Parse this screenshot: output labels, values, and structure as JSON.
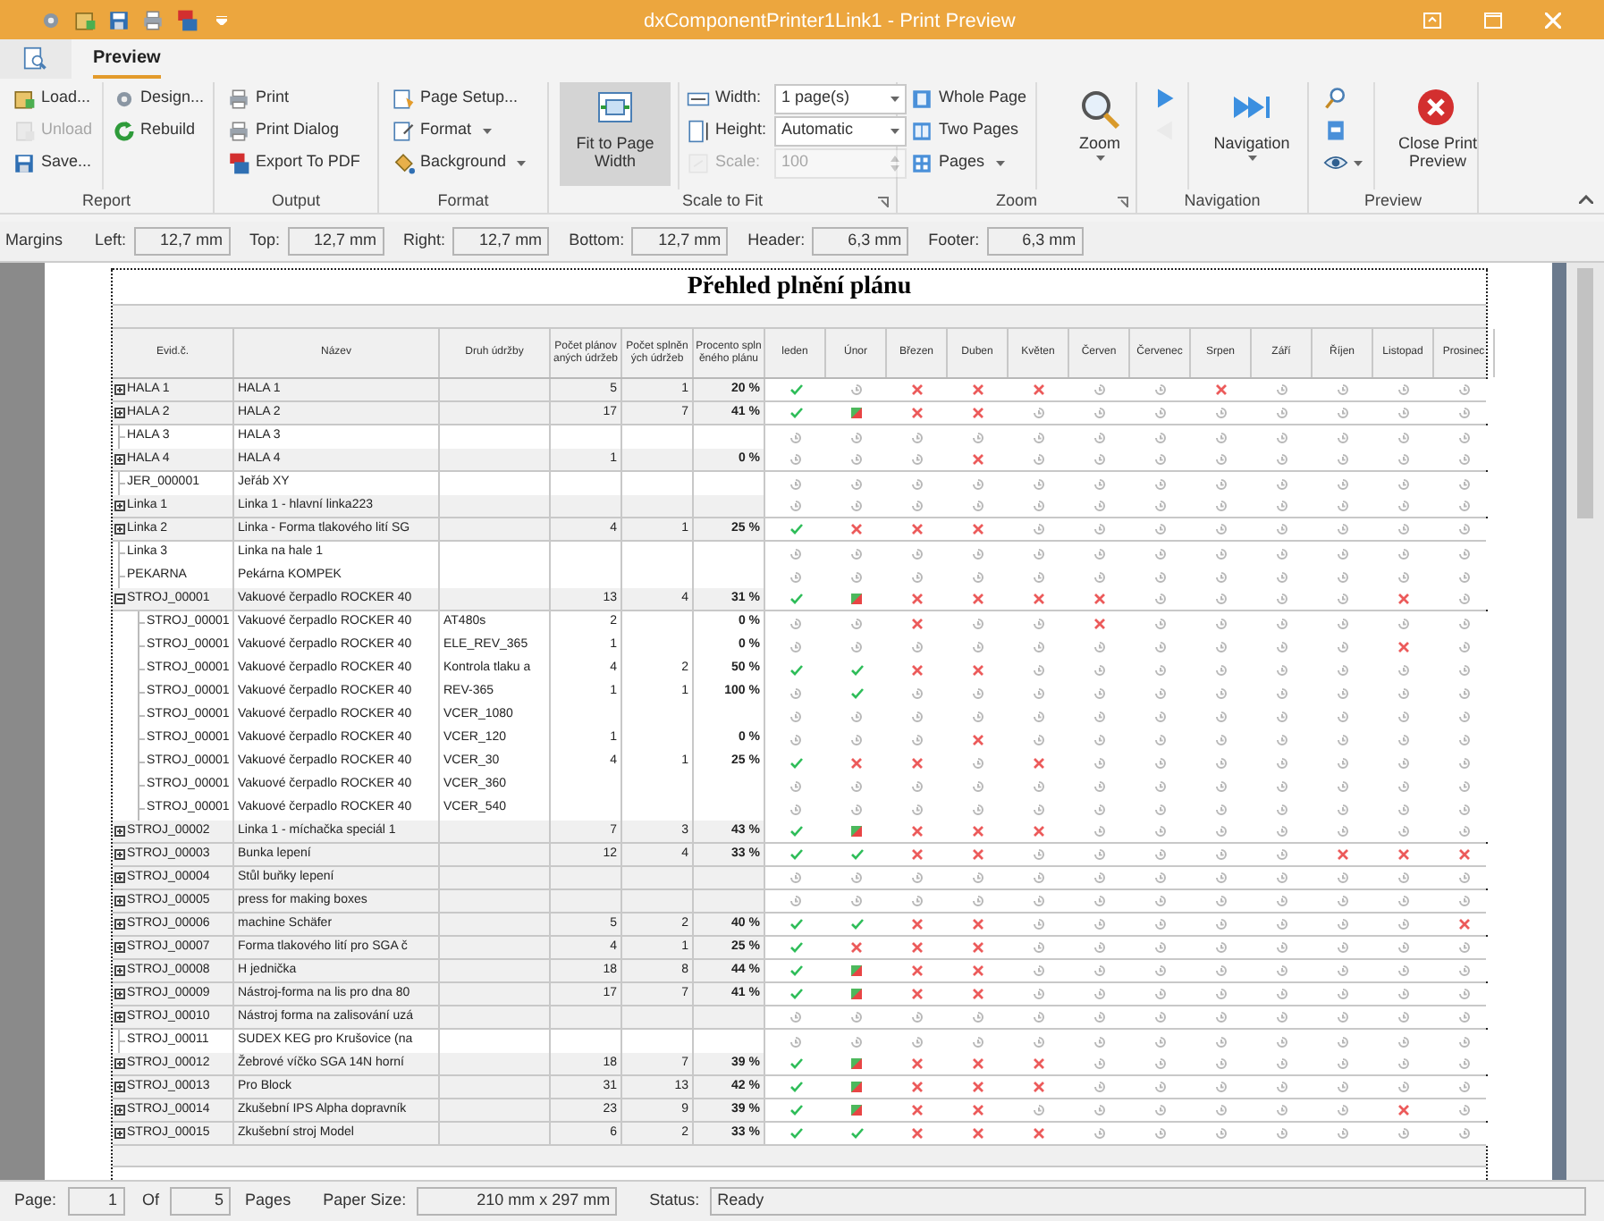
{
  "window": {
    "title": "dxComponentPrinter1Link1 - Print Preview"
  },
  "tabs": [
    {
      "label": "Preview",
      "selected": true
    }
  ],
  "ribbon": {
    "groups": [
      {
        "label": "Report",
        "launcher": false,
        "columns": [
          [
            {
              "kind": "small",
              "label": "Load...",
              "disabled": false
            },
            {
              "kind": "small",
              "label": "Unload",
              "disabled": true
            },
            {
              "kind": "small",
              "label": "Save...",
              "disabled": false
            }
          ],
          [
            {
              "kind": "small",
              "label": "Design...",
              "disabled": false
            },
            {
              "kind": "small",
              "label": "Rebuild",
              "disabled": false
            }
          ]
        ]
      },
      {
        "label": "Output",
        "launcher": false,
        "columns": [
          [
            {
              "kind": "small",
              "label": "Print",
              "disabled": false
            },
            {
              "kind": "small",
              "label": "Print Dialog",
              "disabled": false
            },
            {
              "kind": "small",
              "label": "Export To PDF",
              "disabled": false
            }
          ]
        ]
      },
      {
        "label": "Format",
        "launcher": false,
        "columns": [
          [
            {
              "kind": "small",
              "label": "Page Setup...",
              "disabled": false
            },
            {
              "kind": "small",
              "label": "Format",
              "disabled": false,
              "dropdown": true
            },
            {
              "kind": "small",
              "label": "Background",
              "disabled": false,
              "dropdown": true
            }
          ]
        ]
      },
      {
        "label": "Scale to Fit",
        "launcher": true,
        "columns": [
          [
            {
              "kind": "large",
              "label": "Fit to Page Width",
              "disabled": false,
              "selected": true
            }
          ],
          [
            {
              "kind": "combo",
              "label": "Width:",
              "value": "1 page(s)",
              "disabled": false
            },
            {
              "kind": "combo",
              "label": "Height:",
              "value": "Automatic",
              "disabled": false
            },
            {
              "kind": "spin",
              "label": "Scale:",
              "value": "100",
              "disabled": true
            }
          ]
        ]
      },
      {
        "label": "Zoom",
        "launcher": true,
        "columns": [
          [
            {
              "kind": "small",
              "label": "Whole Page",
              "disabled": false
            },
            {
              "kind": "small",
              "label": "Two Pages",
              "disabled": false
            },
            {
              "kind": "small",
              "label": "Pages",
              "disabled": false,
              "dropdown": true
            }
          ],
          [
            {
              "kind": "large",
              "label": "Zoom",
              "disabled": false,
              "selected": false,
              "dropdown": true
            }
          ]
        ]
      },
      {
        "label": "Navigation",
        "launcher": false,
        "columns": [
          [
            {
              "kind": "icon",
              "disabled": false
            },
            {
              "kind": "icon",
              "disabled": true
            }
          ],
          [
            {
              "kind": "large",
              "label": "Navigation",
              "disabled": false,
              "selected": false,
              "dropdown": true
            }
          ]
        ]
      },
      {
        "label": "Preview",
        "launcher": false,
        "columns": [
          [
            {
              "kind": "icon",
              "disabled": false
            },
            {
              "kind": "icon",
              "disabled": false
            },
            {
              "kind": "icon",
              "disabled": false,
              "dropdown": true
            }
          ],
          [
            {
              "kind": "large",
              "label": "Close Print Preview",
              "disabled": false,
              "selected": false
            }
          ]
        ]
      }
    ]
  },
  "margins": {
    "label": "Margins",
    "fields": [
      {
        "label": "Left:",
        "value": "12,7 mm"
      },
      {
        "label": "Top:",
        "value": "12,7 mm"
      },
      {
        "label": "Right:",
        "value": "12,7 mm"
      },
      {
        "label": "Bottom:",
        "value": "12,7 mm"
      },
      {
        "label": "Header:",
        "value": "6,3 mm"
      },
      {
        "label": "Footer:",
        "value": "6,3 mm"
      }
    ]
  },
  "report": {
    "title": "Přehled plnění plánu",
    "columns": [
      "Evid.č.",
      "Název",
      "Druh údržby",
      "Počet plánovaných údržeb",
      "Počet splněných údržeb",
      "Procento splněného plánu",
      "leden",
      "Únor",
      "Březen",
      "Duben",
      "Květen",
      "Červen",
      "Červenec",
      "Srpen",
      "Září",
      "Říjen",
      "Listopad",
      "Prosinec"
    ],
    "rows": [
      {
        "kind": "group",
        "expanded": false,
        "id": "HALA 1",
        "name": "HALA 1",
        "planned": "5",
        "done": "1",
        "percent": "20 %",
        "months": [
          {
            "kind": "done"
          },
          {
            "kind": "open"
          },
          {
            "kind": "missed"
          },
          {
            "kind": "missed"
          },
          {
            "kind": "missed"
          },
          {
            "kind": "open"
          },
          {
            "kind": "open"
          },
          {
            "kind": "missed"
          },
          {
            "kind": "open"
          },
          {
            "kind": "open"
          },
          {
            "kind": "open"
          },
          {
            "kind": "open"
          }
        ]
      },
      {
        "kind": "group",
        "expanded": false,
        "id": "HALA 2",
        "name": "HALA 2",
        "planned": "17",
        "done": "7",
        "percent": "41 %",
        "months": [
          {
            "kind": "done"
          },
          {
            "kind": "partial"
          },
          {
            "kind": "missed"
          },
          {
            "kind": "missed"
          },
          {
            "kind": "open"
          },
          {
            "kind": "open"
          },
          {
            "kind": "open"
          },
          {
            "kind": "open"
          },
          {
            "kind": "open"
          },
          {
            "kind": "open"
          },
          {
            "kind": "open"
          },
          {
            "kind": "open"
          }
        ]
      },
      {
        "kind": "leaf",
        "id": "HALA 3",
        "name": "HALA 3",
        "months": [
          {
            "kind": "open"
          },
          {
            "kind": "open"
          },
          {
            "kind": "open"
          },
          {
            "kind": "open"
          },
          {
            "kind": "open"
          },
          {
            "kind": "open"
          },
          {
            "kind": "open"
          },
          {
            "kind": "open"
          },
          {
            "kind": "open"
          },
          {
            "kind": "open"
          },
          {
            "kind": "open"
          },
          {
            "kind": "open"
          }
        ]
      },
      {
        "kind": "group",
        "expanded": false,
        "id": "HALA 4",
        "name": "HALA 4",
        "planned": "1",
        "percent": "0 %",
        "months": [
          {
            "kind": "open"
          },
          {
            "kind": "open"
          },
          {
            "kind": "open"
          },
          {
            "kind": "missed"
          },
          {
            "kind": "open"
          },
          {
            "kind": "open"
          },
          {
            "kind": "open"
          },
          {
            "kind": "open"
          },
          {
            "kind": "open"
          },
          {
            "kind": "open"
          },
          {
            "kind": "open"
          },
          {
            "kind": "open"
          }
        ]
      },
      {
        "kind": "leaf",
        "id": "JER_000001",
        "name": "Jeřáb XY",
        "months": [
          {
            "kind": "open"
          },
          {
            "kind": "open"
          },
          {
            "kind": "open"
          },
          {
            "kind": "open"
          },
          {
            "kind": "open"
          },
          {
            "kind": "open"
          },
          {
            "kind": "open"
          },
          {
            "kind": "open"
          },
          {
            "kind": "open"
          },
          {
            "kind": "open"
          },
          {
            "kind": "open"
          },
          {
            "kind": "open"
          }
        ]
      },
      {
        "kind": "group",
        "expanded": false,
        "id": "Linka 1",
        "name": "Linka 1 - hlavní linka223",
        "months": [
          {
            "kind": "open"
          },
          {
            "kind": "open"
          },
          {
            "kind": "open"
          },
          {
            "kind": "open"
          },
          {
            "kind": "open"
          },
          {
            "kind": "open"
          },
          {
            "kind": "open"
          },
          {
            "kind": "open"
          },
          {
            "kind": "open"
          },
          {
            "kind": "open"
          },
          {
            "kind": "open"
          },
          {
            "kind": "open"
          }
        ]
      },
      {
        "kind": "group",
        "expanded": false,
        "id": "Linka 2",
        "name": "Linka - Forma tlakového lití SG",
        "planned": "4",
        "done": "1",
        "percent": "25 %",
        "months": [
          {
            "kind": "done"
          },
          {
            "kind": "missed"
          },
          {
            "kind": "missed"
          },
          {
            "kind": "missed"
          },
          {
            "kind": "open"
          },
          {
            "kind": "open"
          },
          {
            "kind": "open"
          },
          {
            "kind": "open"
          },
          {
            "kind": "open"
          },
          {
            "kind": "open"
          },
          {
            "kind": "open"
          },
          {
            "kind": "open"
          }
        ]
      },
      {
        "kind": "leaf",
        "id": "Linka 3",
        "name": "Linka na hale 1",
        "months": [
          {
            "kind": "open"
          },
          {
            "kind": "open"
          },
          {
            "kind": "open"
          },
          {
            "kind": "open"
          },
          {
            "kind": "open"
          },
          {
            "kind": "open"
          },
          {
            "kind": "open"
          },
          {
            "kind": "open"
          },
          {
            "kind": "open"
          },
          {
            "kind": "open"
          },
          {
            "kind": "open"
          },
          {
            "kind": "open"
          }
        ]
      },
      {
        "kind": "leaf",
        "id": "PEKARNA",
        "name": "Pekárna KOMPEK",
        "months": [
          {
            "kind": "open"
          },
          {
            "kind": "open"
          },
          {
            "kind": "open"
          },
          {
            "kind": "open"
          },
          {
            "kind": "open"
          },
          {
            "kind": "open"
          },
          {
            "kind": "open"
          },
          {
            "kind": "open"
          },
          {
            "kind": "open"
          },
          {
            "kind": "open"
          },
          {
            "kind": "open"
          },
          {
            "kind": "open"
          }
        ]
      },
      {
        "kind": "group",
        "expanded": true,
        "id": "STROJ_00001",
        "name": "Vakuové čerpadlo ROCKER 40",
        "planned": "13",
        "done": "4",
        "percent": "31 %",
        "months": [
          {
            "kind": "done"
          },
          {
            "kind": "partial"
          },
          {
            "kind": "missed"
          },
          {
            "kind": "missed"
          },
          {
            "kind": "missed"
          },
          {
            "kind": "missed"
          },
          {
            "kind": "open"
          },
          {
            "kind": "open"
          },
          {
            "kind": "open"
          },
          {
            "kind": "open"
          },
          {
            "kind": "missed"
          },
          {
            "kind": "open"
          }
        ],
        "children": [
          {
            "kind": "leaf",
            "id": "STROJ_00001",
            "name": "Vakuové čerpadlo ROCKER 40",
            "type": "AT480s",
            "planned": "2",
            "percent": "0 %",
            "months": [
              {
                "kind": "open"
              },
              {
                "kind": "open"
              },
              {
                "kind": "missed"
              },
              {
                "kind": "open"
              },
              {
                "kind": "open"
              },
              {
                "kind": "missed"
              },
              {
                "kind": "open"
              },
              {
                "kind": "open"
              },
              {
                "kind": "open"
              },
              {
                "kind": "open"
              },
              {
                "kind": "open"
              },
              {
                "kind": "open"
              }
            ]
          },
          {
            "kind": "leaf",
            "id": "STROJ_00001",
            "name": "Vakuové čerpadlo ROCKER 40",
            "type": "ELE_REV_365",
            "planned": "1",
            "percent": "0 %",
            "months": [
              {
                "kind": "open"
              },
              {
                "kind": "open"
              },
              {
                "kind": "open"
              },
              {
                "kind": "open"
              },
              {
                "kind": "open"
              },
              {
                "kind": "open"
              },
              {
                "kind": "open"
              },
              {
                "kind": "open"
              },
              {
                "kind": "open"
              },
              {
                "kind": "open"
              },
              {
                "kind": "missed"
              },
              {
                "kind": "open"
              }
            ]
          },
          {
            "kind": "leaf",
            "id": "STROJ_00001",
            "name": "Vakuové čerpadlo ROCKER 40",
            "type": "Kontrola tlaku a",
            "planned": "4",
            "done": "2",
            "percent": "50 %",
            "months": [
              {
                "kind": "done"
              },
              {
                "kind": "done"
              },
              {
                "kind": "missed"
              },
              {
                "kind": "missed"
              },
              {
                "kind": "open"
              },
              {
                "kind": "open"
              },
              {
                "kind": "open"
              },
              {
                "kind": "open"
              },
              {
                "kind": "open"
              },
              {
                "kind": "open"
              },
              {
                "kind": "open"
              },
              {
                "kind": "open"
              }
            ]
          },
          {
            "kind": "leaf",
            "id": "STROJ_00001",
            "name": "Vakuové čerpadlo ROCKER 40",
            "type": "REV-365",
            "planned": "1",
            "done": "1",
            "percent": "100 %",
            "months": [
              {
                "kind": "open"
              },
              {
                "kind": "done"
              },
              {
                "kind": "open"
              },
              {
                "kind": "open"
              },
              {
                "kind": "open"
              },
              {
                "kind": "open"
              },
              {
                "kind": "open"
              },
              {
                "kind": "open"
              },
              {
                "kind": "open"
              },
              {
                "kind": "open"
              },
              {
                "kind": "open"
              },
              {
                "kind": "open"
              }
            ]
          },
          {
            "kind": "leaf",
            "id": "STROJ_00001",
            "name": "Vakuové čerpadlo ROCKER 40",
            "type": "VCER_1080",
            "months": [
              {
                "kind": "open"
              },
              {
                "kind": "open"
              },
              {
                "kind": "open"
              },
              {
                "kind": "open"
              },
              {
                "kind": "open"
              },
              {
                "kind": "open"
              },
              {
                "kind": "open"
              },
              {
                "kind": "open"
              },
              {
                "kind": "open"
              },
              {
                "kind": "open"
              },
              {
                "kind": "open"
              },
              {
                "kind": "open"
              }
            ]
          },
          {
            "kind": "leaf",
            "id": "STROJ_00001",
            "name": "Vakuové čerpadlo ROCKER 40",
            "type": "VCER_120",
            "planned": "1",
            "percent": "0 %",
            "months": [
              {
                "kind": "open"
              },
              {
                "kind": "open"
              },
              {
                "kind": "open"
              },
              {
                "kind": "missed"
              },
              {
                "kind": "open"
              },
              {
                "kind": "open"
              },
              {
                "kind": "open"
              },
              {
                "kind": "open"
              },
              {
                "kind": "open"
              },
              {
                "kind": "open"
              },
              {
                "kind": "open"
              },
              {
                "kind": "open"
              }
            ]
          },
          {
            "kind": "leaf",
            "id": "STROJ_00001",
            "name": "Vakuové čerpadlo ROCKER 40",
            "type": "VCER_30",
            "planned": "4",
            "done": "1",
            "percent": "25 %",
            "months": [
              {
                "kind": "done"
              },
              {
                "kind": "missed"
              },
              {
                "kind": "missed"
              },
              {
                "kind": "open"
              },
              {
                "kind": "missed"
              },
              {
                "kind": "open"
              },
              {
                "kind": "open"
              },
              {
                "kind": "open"
              },
              {
                "kind": "open"
              },
              {
                "kind": "open"
              },
              {
                "kind": "open"
              },
              {
                "kind": "open"
              }
            ]
          },
          {
            "kind": "leaf",
            "id": "STROJ_00001",
            "name": "Vakuové čerpadlo ROCKER 40",
            "type": "VCER_360",
            "months": [
              {
                "kind": "open"
              },
              {
                "kind": "open"
              },
              {
                "kind": "open"
              },
              {
                "kind": "open"
              },
              {
                "kind": "open"
              },
              {
                "kind": "open"
              },
              {
                "kind": "open"
              },
              {
                "kind": "open"
              },
              {
                "kind": "open"
              },
              {
                "kind": "open"
              },
              {
                "kind": "open"
              },
              {
                "kind": "open"
              }
            ]
          },
          {
            "kind": "leaf",
            "id": "STROJ_00001",
            "name": "Vakuové čerpadlo ROCKER 40",
            "type": "VCER_540",
            "months": [
              {
                "kind": "open"
              },
              {
                "kind": "open"
              },
              {
                "kind": "open"
              },
              {
                "kind": "open"
              },
              {
                "kind": "open"
              },
              {
                "kind": "open"
              },
              {
                "kind": "open"
              },
              {
                "kind": "open"
              },
              {
                "kind": "open"
              },
              {
                "kind": "open"
              },
              {
                "kind": "open"
              },
              {
                "kind": "open"
              }
            ]
          }
        ]
      },
      {
        "kind": "group",
        "expanded": false,
        "id": "STROJ_00002",
        "name": "Linka 1 - míchačka speciál 1",
        "planned": "7",
        "done": "3",
        "percent": "43 %",
        "months": [
          {
            "kind": "done"
          },
          {
            "kind": "partial"
          },
          {
            "kind": "missed"
          },
          {
            "kind": "missed"
          },
          {
            "kind": "missed"
          },
          {
            "kind": "open"
          },
          {
            "kind": "open"
          },
          {
            "kind": "open"
          },
          {
            "kind": "open"
          },
          {
            "kind": "open"
          },
          {
            "kind": "open"
          },
          {
            "kind": "open"
          }
        ]
      },
      {
        "kind": "group",
        "expanded": false,
        "id": "STROJ_00003",
        "name": "Bunka lepení",
        "planned": "12",
        "done": "4",
        "percent": "33 %",
        "months": [
          {
            "kind": "done"
          },
          {
            "kind": "done"
          },
          {
            "kind": "missed"
          },
          {
            "kind": "missed"
          },
          {
            "kind": "open"
          },
          {
            "kind": "open"
          },
          {
            "kind": "open"
          },
          {
            "kind": "open"
          },
          {
            "kind": "open"
          },
          {
            "kind": "missed"
          },
          {
            "kind": "missed"
          },
          {
            "kind": "missed"
          }
        ]
      },
      {
        "kind": "group",
        "expanded": false,
        "id": "STROJ_00004",
        "name": "Stůl buňky lepení",
        "months": [
          {
            "kind": "open"
          },
          {
            "kind": "open"
          },
          {
            "kind": "open"
          },
          {
            "kind": "open"
          },
          {
            "kind": "open"
          },
          {
            "kind": "open"
          },
          {
            "kind": "open"
          },
          {
            "kind": "open"
          },
          {
            "kind": "open"
          },
          {
            "kind": "open"
          },
          {
            "kind": "open"
          },
          {
            "kind": "open"
          }
        ]
      },
      {
        "kind": "group",
        "expanded": false,
        "id": "STROJ_00005",
        "name": "press for making boxes",
        "months": [
          {
            "kind": "open"
          },
          {
            "kind": "open"
          },
          {
            "kind": "open"
          },
          {
            "kind": "open"
          },
          {
            "kind": "open"
          },
          {
            "kind": "open"
          },
          {
            "kind": "open"
          },
          {
            "kind": "open"
          },
          {
            "kind": "open"
          },
          {
            "kind": "open"
          },
          {
            "kind": "open"
          },
          {
            "kind": "open"
          }
        ]
      },
      {
        "kind": "group",
        "expanded": false,
        "id": "STROJ_00006",
        "name": "machine Schäfer",
        "planned": "5",
        "done": "2",
        "percent": "40 %",
        "months": [
          {
            "kind": "done"
          },
          {
            "kind": "done"
          },
          {
            "kind": "missed"
          },
          {
            "kind": "missed"
          },
          {
            "kind": "open"
          },
          {
            "kind": "open"
          },
          {
            "kind": "open"
          },
          {
            "kind": "open"
          },
          {
            "kind": "open"
          },
          {
            "kind": "open"
          },
          {
            "kind": "open"
          },
          {
            "kind": "missed"
          }
        ]
      },
      {
        "kind": "group",
        "expanded": false,
        "id": "STROJ_00007",
        "name": "Forma tlakového lití pro SGA č",
        "planned": "4",
        "done": "1",
        "percent": "25 %",
        "months": [
          {
            "kind": "done"
          },
          {
            "kind": "missed"
          },
          {
            "kind": "missed"
          },
          {
            "kind": "missed"
          },
          {
            "kind": "open"
          },
          {
            "kind": "open"
          },
          {
            "kind": "open"
          },
          {
            "kind": "open"
          },
          {
            "kind": "open"
          },
          {
            "kind": "open"
          },
          {
            "kind": "open"
          },
          {
            "kind": "open"
          }
        ]
      },
      {
        "kind": "group",
        "expanded": false,
        "id": "STROJ_00008",
        "name": "H jednička",
        "planned": "18",
        "done": "8",
        "percent": "44 %",
        "months": [
          {
            "kind": "done"
          },
          {
            "kind": "partial"
          },
          {
            "kind": "missed"
          },
          {
            "kind": "missed"
          },
          {
            "kind": "open"
          },
          {
            "kind": "open"
          },
          {
            "kind": "open"
          },
          {
            "kind": "open"
          },
          {
            "kind": "open"
          },
          {
            "kind": "open"
          },
          {
            "kind": "open"
          },
          {
            "kind": "open"
          }
        ]
      },
      {
        "kind": "group",
        "expanded": false,
        "id": "STROJ_00009",
        "name": "Nástroj-forma na lis pro dna 80",
        "planned": "17",
        "done": "7",
        "percent": "41 %",
        "months": [
          {
            "kind": "done"
          },
          {
            "kind": "partial"
          },
          {
            "kind": "missed"
          },
          {
            "kind": "missed"
          },
          {
            "kind": "open"
          },
          {
            "kind": "open"
          },
          {
            "kind": "open"
          },
          {
            "kind": "open"
          },
          {
            "kind": "open"
          },
          {
            "kind": "open"
          },
          {
            "kind": "open"
          },
          {
            "kind": "open"
          }
        ]
      },
      {
        "kind": "group",
        "expanded": false,
        "id": "STROJ_00010",
        "name": "Nástroj forma na zalisování uzá",
        "months": [
          {
            "kind": "open"
          },
          {
            "kind": "open"
          },
          {
            "kind": "open"
          },
          {
            "kind": "open"
          },
          {
            "kind": "open"
          },
          {
            "kind": "open"
          },
          {
            "kind": "open"
          },
          {
            "kind": "open"
          },
          {
            "kind": "open"
          },
          {
            "kind": "open"
          },
          {
            "kind": "open"
          },
          {
            "kind": "open"
          }
        ]
      },
      {
        "kind": "leaf",
        "id": "STROJ_00011",
        "name": "SUDEX KEG pro Krušovice (na",
        "months": [
          {
            "kind": "open"
          },
          {
            "kind": "open"
          },
          {
            "kind": "open"
          },
          {
            "kind": "open"
          },
          {
            "kind": "open"
          },
          {
            "kind": "open"
          },
          {
            "kind": "open"
          },
          {
            "kind": "open"
          },
          {
            "kind": "open"
          },
          {
            "kind": "open"
          },
          {
            "kind": "open"
          },
          {
            "kind": "open"
          }
        ]
      },
      {
        "kind": "group",
        "expanded": false,
        "id": "STROJ_00012",
        "name": "Žebrové víčko SGA 14N horní",
        "planned": "18",
        "done": "7",
        "percent": "39 %",
        "months": [
          {
            "kind": "done"
          },
          {
            "kind": "partial"
          },
          {
            "kind": "missed"
          },
          {
            "kind": "missed"
          },
          {
            "kind": "missed"
          },
          {
            "kind": "open"
          },
          {
            "kind": "open"
          },
          {
            "kind": "open"
          },
          {
            "kind": "open"
          },
          {
            "kind": "open"
          },
          {
            "kind": "open"
          },
          {
            "kind": "open"
          }
        ]
      },
      {
        "kind": "group",
        "expanded": false,
        "id": "STROJ_00013",
        "name": "Pro Block",
        "planned": "31",
        "done": "13",
        "percent": "42 %",
        "months": [
          {
            "kind": "done"
          },
          {
            "kind": "partial"
          },
          {
            "kind": "missed"
          },
          {
            "kind": "missed"
          },
          {
            "kind": "missed"
          },
          {
            "kind": "open"
          },
          {
            "kind": "open"
          },
          {
            "kind": "open"
          },
          {
            "kind": "open"
          },
          {
            "kind": "open"
          },
          {
            "kind": "open"
          },
          {
            "kind": "open"
          }
        ]
      },
      {
        "kind": "group",
        "expanded": false,
        "id": "STROJ_00014",
        "name": "Zkušební IPS Alpha dopravník",
        "planned": "23",
        "done": "9",
        "percent": "39 %",
        "months": [
          {
            "kind": "done"
          },
          {
            "kind": "partial"
          },
          {
            "kind": "missed"
          },
          {
            "kind": "missed"
          },
          {
            "kind": "open"
          },
          {
            "kind": "open"
          },
          {
            "kind": "open"
          },
          {
            "kind": "open"
          },
          {
            "kind": "open"
          },
          {
            "kind": "open"
          },
          {
            "kind": "missed"
          },
          {
            "kind": "open"
          }
        ]
      },
      {
        "kind": "group",
        "expanded": false,
        "id": "STROJ_00015",
        "name": "Zkušební stroj Model",
        "planned": "6",
        "done": "2",
        "percent": "33 %",
        "months": [
          {
            "kind": "done"
          },
          {
            "kind": "done"
          },
          {
            "kind": "missed"
          },
          {
            "kind": "missed"
          },
          {
            "kind": "missed"
          },
          {
            "kind": "open"
          },
          {
            "kind": "open"
          },
          {
            "kind": "open"
          },
          {
            "kind": "open"
          },
          {
            "kind": "open"
          },
          {
            "kind": "open"
          },
          {
            "kind": "open"
          }
        ]
      }
    ]
  },
  "status_bar": {
    "page_label": "Page:",
    "page": "1",
    "of_label": "Of",
    "pages": "5",
    "pages_label": "Pages",
    "paper_label": "Paper Size:",
    "paper": "210 mm x 297 mm",
    "status_label": "Status:",
    "status": "Ready"
  }
}
